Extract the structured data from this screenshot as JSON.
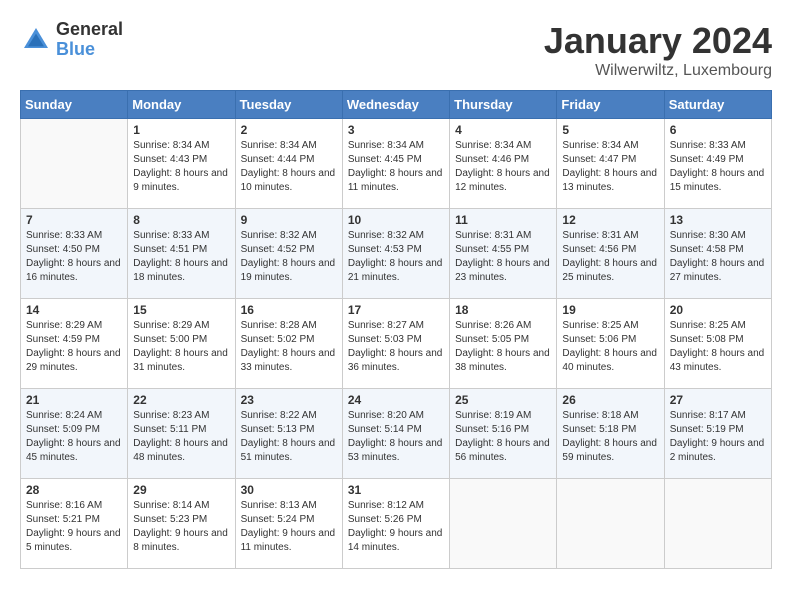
{
  "header": {
    "logo_general": "General",
    "logo_blue": "Blue",
    "month_title": "January 2024",
    "location": "Wilwerwiltz, Luxembourg"
  },
  "days_of_week": [
    "Sunday",
    "Monday",
    "Tuesday",
    "Wednesday",
    "Thursday",
    "Friday",
    "Saturday"
  ],
  "weeks": [
    [
      {
        "day": "",
        "sunrise": "",
        "sunset": "",
        "daylight": ""
      },
      {
        "day": "1",
        "sunrise": "Sunrise: 8:34 AM",
        "sunset": "Sunset: 4:43 PM",
        "daylight": "Daylight: 8 hours and 9 minutes."
      },
      {
        "day": "2",
        "sunrise": "Sunrise: 8:34 AM",
        "sunset": "Sunset: 4:44 PM",
        "daylight": "Daylight: 8 hours and 10 minutes."
      },
      {
        "day": "3",
        "sunrise": "Sunrise: 8:34 AM",
        "sunset": "Sunset: 4:45 PM",
        "daylight": "Daylight: 8 hours and 11 minutes."
      },
      {
        "day": "4",
        "sunrise": "Sunrise: 8:34 AM",
        "sunset": "Sunset: 4:46 PM",
        "daylight": "Daylight: 8 hours and 12 minutes."
      },
      {
        "day": "5",
        "sunrise": "Sunrise: 8:34 AM",
        "sunset": "Sunset: 4:47 PM",
        "daylight": "Daylight: 8 hours and 13 minutes."
      },
      {
        "day": "6",
        "sunrise": "Sunrise: 8:33 AM",
        "sunset": "Sunset: 4:49 PM",
        "daylight": "Daylight: 8 hours and 15 minutes."
      }
    ],
    [
      {
        "day": "7",
        "sunrise": "Sunrise: 8:33 AM",
        "sunset": "Sunset: 4:50 PM",
        "daylight": "Daylight: 8 hours and 16 minutes."
      },
      {
        "day": "8",
        "sunrise": "Sunrise: 8:33 AM",
        "sunset": "Sunset: 4:51 PM",
        "daylight": "Daylight: 8 hours and 18 minutes."
      },
      {
        "day": "9",
        "sunrise": "Sunrise: 8:32 AM",
        "sunset": "Sunset: 4:52 PM",
        "daylight": "Daylight: 8 hours and 19 minutes."
      },
      {
        "day": "10",
        "sunrise": "Sunrise: 8:32 AM",
        "sunset": "Sunset: 4:53 PM",
        "daylight": "Daylight: 8 hours and 21 minutes."
      },
      {
        "day": "11",
        "sunrise": "Sunrise: 8:31 AM",
        "sunset": "Sunset: 4:55 PM",
        "daylight": "Daylight: 8 hours and 23 minutes."
      },
      {
        "day": "12",
        "sunrise": "Sunrise: 8:31 AM",
        "sunset": "Sunset: 4:56 PM",
        "daylight": "Daylight: 8 hours and 25 minutes."
      },
      {
        "day": "13",
        "sunrise": "Sunrise: 8:30 AM",
        "sunset": "Sunset: 4:58 PM",
        "daylight": "Daylight: 8 hours and 27 minutes."
      }
    ],
    [
      {
        "day": "14",
        "sunrise": "Sunrise: 8:29 AM",
        "sunset": "Sunset: 4:59 PM",
        "daylight": "Daylight: 8 hours and 29 minutes."
      },
      {
        "day": "15",
        "sunrise": "Sunrise: 8:29 AM",
        "sunset": "Sunset: 5:00 PM",
        "daylight": "Daylight: 8 hours and 31 minutes."
      },
      {
        "day": "16",
        "sunrise": "Sunrise: 8:28 AM",
        "sunset": "Sunset: 5:02 PM",
        "daylight": "Daylight: 8 hours and 33 minutes."
      },
      {
        "day": "17",
        "sunrise": "Sunrise: 8:27 AM",
        "sunset": "Sunset: 5:03 PM",
        "daylight": "Daylight: 8 hours and 36 minutes."
      },
      {
        "day": "18",
        "sunrise": "Sunrise: 8:26 AM",
        "sunset": "Sunset: 5:05 PM",
        "daylight": "Daylight: 8 hours and 38 minutes."
      },
      {
        "day": "19",
        "sunrise": "Sunrise: 8:25 AM",
        "sunset": "Sunset: 5:06 PM",
        "daylight": "Daylight: 8 hours and 40 minutes."
      },
      {
        "day": "20",
        "sunrise": "Sunrise: 8:25 AM",
        "sunset": "Sunset: 5:08 PM",
        "daylight": "Daylight: 8 hours and 43 minutes."
      }
    ],
    [
      {
        "day": "21",
        "sunrise": "Sunrise: 8:24 AM",
        "sunset": "Sunset: 5:09 PM",
        "daylight": "Daylight: 8 hours and 45 minutes."
      },
      {
        "day": "22",
        "sunrise": "Sunrise: 8:23 AM",
        "sunset": "Sunset: 5:11 PM",
        "daylight": "Daylight: 8 hours and 48 minutes."
      },
      {
        "day": "23",
        "sunrise": "Sunrise: 8:22 AM",
        "sunset": "Sunset: 5:13 PM",
        "daylight": "Daylight: 8 hours and 51 minutes."
      },
      {
        "day": "24",
        "sunrise": "Sunrise: 8:20 AM",
        "sunset": "Sunset: 5:14 PM",
        "daylight": "Daylight: 8 hours and 53 minutes."
      },
      {
        "day": "25",
        "sunrise": "Sunrise: 8:19 AM",
        "sunset": "Sunset: 5:16 PM",
        "daylight": "Daylight: 8 hours and 56 minutes."
      },
      {
        "day": "26",
        "sunrise": "Sunrise: 8:18 AM",
        "sunset": "Sunset: 5:18 PM",
        "daylight": "Daylight: 8 hours and 59 minutes."
      },
      {
        "day": "27",
        "sunrise": "Sunrise: 8:17 AM",
        "sunset": "Sunset: 5:19 PM",
        "daylight": "Daylight: 9 hours and 2 minutes."
      }
    ],
    [
      {
        "day": "28",
        "sunrise": "Sunrise: 8:16 AM",
        "sunset": "Sunset: 5:21 PM",
        "daylight": "Daylight: 9 hours and 5 minutes."
      },
      {
        "day": "29",
        "sunrise": "Sunrise: 8:14 AM",
        "sunset": "Sunset: 5:23 PM",
        "daylight": "Daylight: 9 hours and 8 minutes."
      },
      {
        "day": "30",
        "sunrise": "Sunrise: 8:13 AM",
        "sunset": "Sunset: 5:24 PM",
        "daylight": "Daylight: 9 hours and 11 minutes."
      },
      {
        "day": "31",
        "sunrise": "Sunrise: 8:12 AM",
        "sunset": "Sunset: 5:26 PM",
        "daylight": "Daylight: 9 hours and 14 minutes."
      },
      {
        "day": "",
        "sunrise": "",
        "sunset": "",
        "daylight": ""
      },
      {
        "day": "",
        "sunrise": "",
        "sunset": "",
        "daylight": ""
      },
      {
        "day": "",
        "sunrise": "",
        "sunset": "",
        "daylight": ""
      }
    ]
  ]
}
